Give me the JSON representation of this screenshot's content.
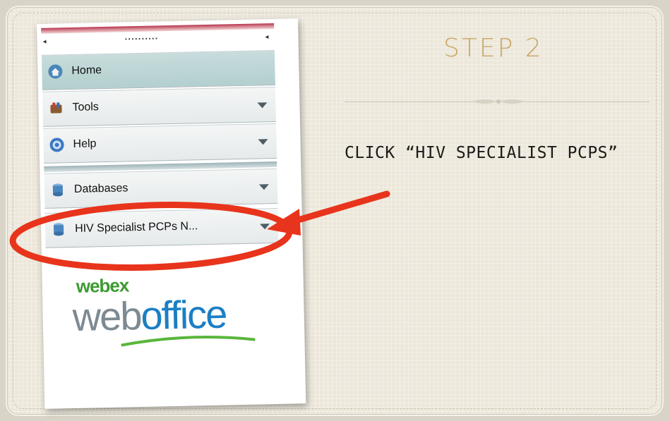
{
  "slide": {
    "step_title": "STEP 2",
    "instruction": "CLICK “HIV SPECIALIST PCPS”"
  },
  "screenshot": {
    "scroll_grip": "..........",
    "scroll_left_arrow": "◂",
    "scroll_right_arrow": "◂",
    "menu": [
      {
        "label": "Home",
        "icon": "home-icon",
        "expandable": false,
        "selected": true
      },
      {
        "label": "Tools",
        "icon": "tools-icon",
        "expandable": true
      },
      {
        "label": "Help",
        "icon": "help-icon",
        "expandable": true
      },
      {
        "label": "Databases",
        "icon": "database-icon",
        "expandable": true
      },
      {
        "label": "HIV Specialist PCPs N...",
        "icon": "database-icon",
        "expandable": true
      }
    ],
    "logo": {
      "webex": "webex",
      "weboffice_prefix": "web",
      "weboffice_suffix": "office"
    }
  },
  "colors": {
    "accent_title": "#c9a866",
    "annotation_red": "#e8341c",
    "webex_green": "#3c9b32",
    "weboffice_blue": "#1b7fc4"
  }
}
